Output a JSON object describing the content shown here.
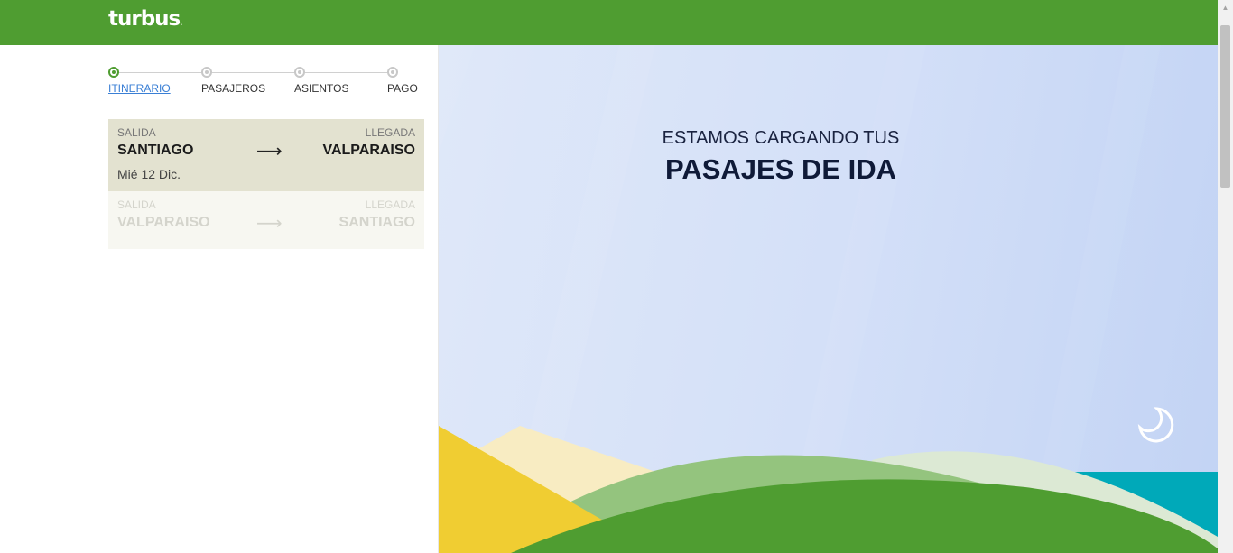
{
  "header": {
    "logo_text": "turbus",
    "logo_dot": "."
  },
  "steps": [
    {
      "label": "ITINERARIO",
      "active": true
    },
    {
      "label": "PASAJEROS",
      "active": false
    },
    {
      "label": "ASIENTOS",
      "active": false
    },
    {
      "label": "PAGO",
      "active": false
    }
  ],
  "trips": {
    "outbound": {
      "departure_label": "SALIDA",
      "arrival_label": "LLEGADA",
      "origin": "SANTIAGO",
      "destination": "VALPARAISO",
      "arrow": "⟶",
      "date": "Mié 12 Dic."
    },
    "return": {
      "departure_label": "SALIDA",
      "arrival_label": "LLEGADA",
      "origin": "VALPARAISO",
      "destination": "SANTIAGO",
      "arrow": "⟶"
    }
  },
  "loading": {
    "line1": "ESTAMOS CARGANDO TUS",
    "line2": "PASAJES DE IDA"
  },
  "icons": {
    "moon": "moon-icon",
    "scroll_up": "chevron-up-icon"
  },
  "colors": {
    "brand_green": "#4f9d31",
    "active_link": "#3a7fd5",
    "sky": "#d4e0f8"
  }
}
